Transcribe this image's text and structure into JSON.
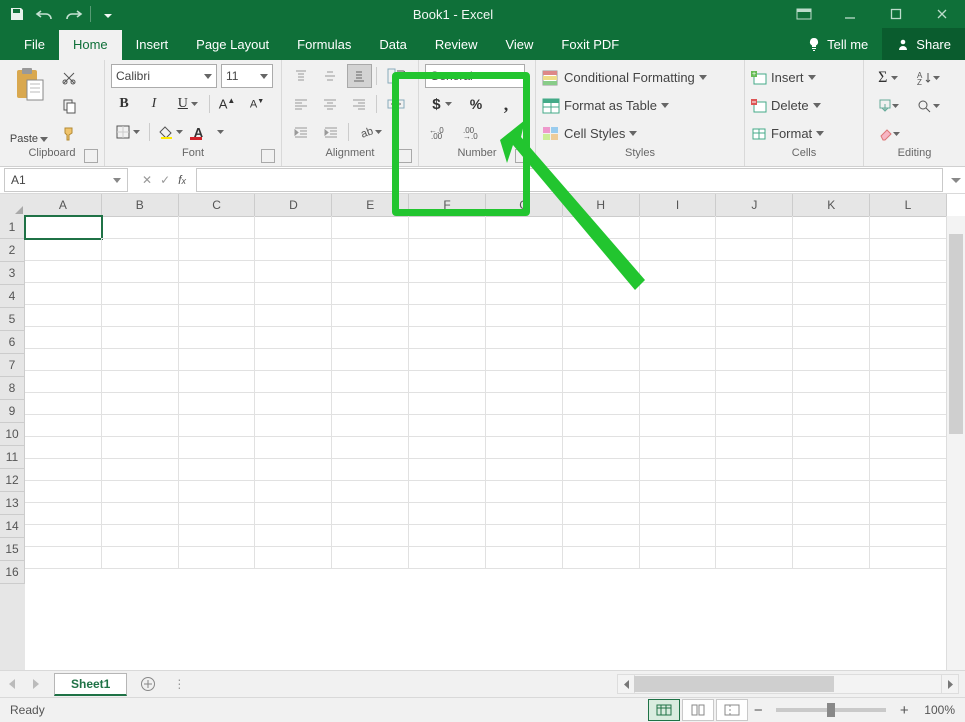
{
  "title": "Book1 - Excel",
  "tabs": [
    "File",
    "Home",
    "Insert",
    "Page Layout",
    "Formulas",
    "Data",
    "Review",
    "View",
    "Foxit PDF"
  ],
  "active_tab": "Home",
  "tellme": "Tell me",
  "share": "Share",
  "clipboard": {
    "paste": "Paste",
    "label": "Clipboard"
  },
  "font": {
    "name": "Calibri",
    "size": "11",
    "label": "Font"
  },
  "alignment": {
    "label": "Alignment"
  },
  "number": {
    "format": "General",
    "label": "Number",
    "currency": "$",
    "percent": "%",
    "comma": ",",
    "inc": "",
    "dec": ""
  },
  "styles": {
    "cond": "Conditional Formatting",
    "table": "Format as Table",
    "cell": "Cell Styles",
    "label": "Styles"
  },
  "cells": {
    "insert": "Insert",
    "delete": "Delete",
    "format": "Format",
    "label": "Cells"
  },
  "editing": {
    "label": "Editing"
  },
  "namebox": "A1",
  "columns": [
    "A",
    "B",
    "C",
    "D",
    "E",
    "F",
    "G",
    "H",
    "I",
    "J",
    "K",
    "L"
  ],
  "rows": 16,
  "sheet": "Sheet1",
  "status": "Ready",
  "zoom": "100%"
}
